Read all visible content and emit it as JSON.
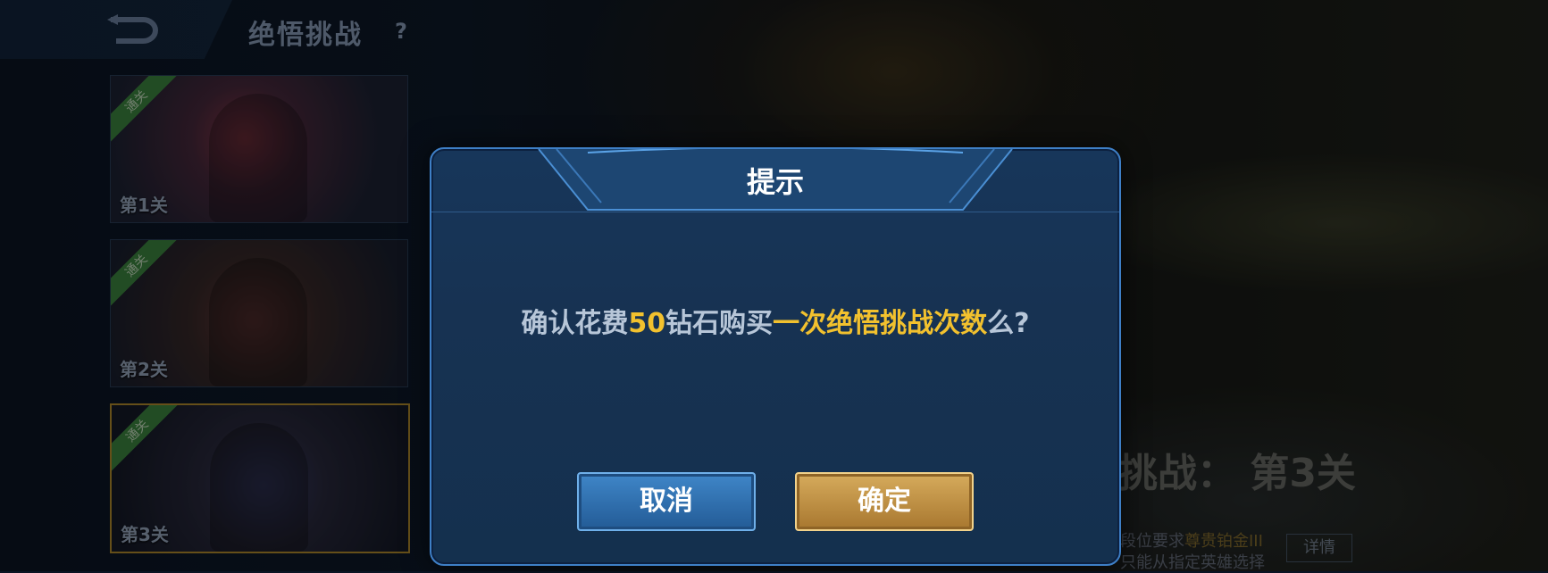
{
  "header": {
    "title": "绝悟挑战",
    "help": "?"
  },
  "stages": [
    {
      "label": "第1关",
      "badge": "通关"
    },
    {
      "label": "第2关",
      "badge": "通关"
    },
    {
      "label": "第3关",
      "badge": "通关"
    }
  ],
  "detail_panel": {
    "challenge_title": "挑战： 第3关",
    "requirement_prefix": "段位要求",
    "requirement_value": "尊贵铂金III",
    "requirement_note": "只能从指定英雄选择",
    "detail_button": "详情"
  },
  "dialog": {
    "title": "提示",
    "message_part1": "确认花费",
    "message_amount": "50",
    "message_part2": "钻石购买",
    "message_item": "一次绝悟挑战次数",
    "message_part3": "么?",
    "cancel_label": "取消",
    "confirm_label": "确定"
  }
}
